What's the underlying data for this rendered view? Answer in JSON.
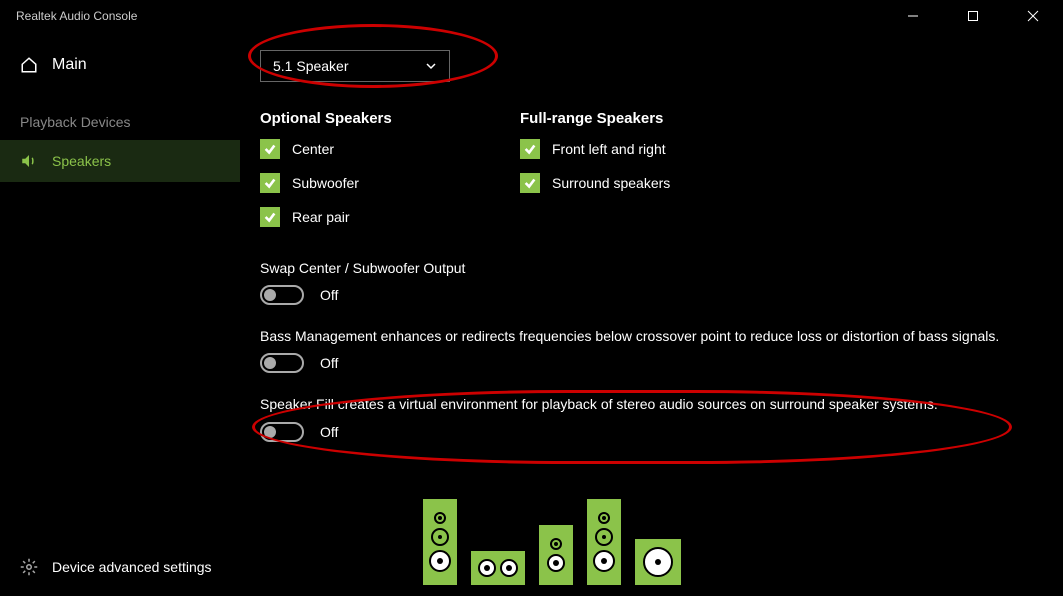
{
  "app_title": "Realtek Audio Console",
  "sidebar": {
    "main": "Main",
    "section_label": "Playback Devices",
    "active_item": "Speakers",
    "bottom_item": "Device advanced settings"
  },
  "dropdown": {
    "selected": "5.1 Speaker"
  },
  "columns": {
    "optional": {
      "header": "Optional Speakers",
      "items": [
        "Center",
        "Subwoofer",
        "Rear pair"
      ]
    },
    "fullrange": {
      "header": "Full-range Speakers",
      "items": [
        "Front left and right",
        "Surround speakers"
      ]
    }
  },
  "settings": {
    "swap": {
      "desc": "Swap Center / Subwoofer Output",
      "state": "Off"
    },
    "bass": {
      "desc": "Bass Management enhances or redirects frequencies below crossover point to reduce loss or distortion of bass signals.",
      "state": "Off"
    },
    "fill": {
      "desc": "Speaker Fill creates a virtual environment for playback of stereo audio sources on surround speaker systems.",
      "state": "Off"
    }
  },
  "colors": {
    "accent": "#8bc34a"
  }
}
